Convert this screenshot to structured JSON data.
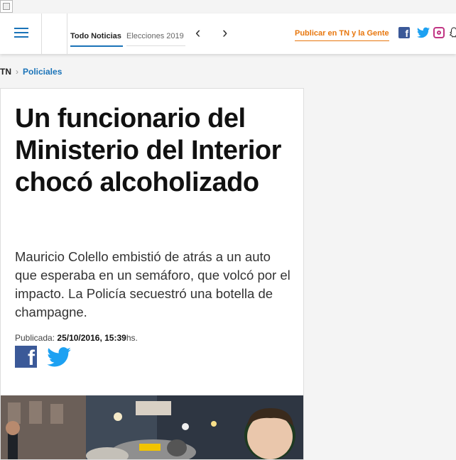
{
  "header": {
    "tabs": [
      {
        "label": "Todo Noticias",
        "active": true
      },
      {
        "label": "Elecciones 2019",
        "active": false
      }
    ],
    "publish_label": "Publicar en TN y la Gente",
    "social_icons": [
      "facebook-icon",
      "twitter-icon",
      "instagram-icon",
      "snapchat-icon"
    ]
  },
  "breadcrumb": {
    "home": "TN",
    "category": "Policiales"
  },
  "article": {
    "title": "Un funcionario del Ministerio del Interior chocó alcoholizado",
    "lead": "Mauricio Colello embistió de atrás a un auto que esperaba en un semáforo, que volcó por el impacto. La Policía secuestró una botella de champagne.",
    "published_label": "Publicada:",
    "published_date": "25/10/2016, 15:39",
    "published_suffix": "hs."
  },
  "colors": {
    "accent_blue": "#1a73b8",
    "accent_orange": "#e8770e",
    "facebook": "#3b5998",
    "twitter": "#1da1f2"
  }
}
